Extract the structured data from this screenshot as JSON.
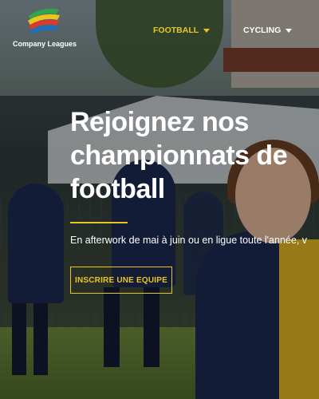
{
  "brand": {
    "name": "Company Leagues"
  },
  "nav": {
    "items": [
      {
        "label": "FOOTBALL",
        "active": true
      },
      {
        "label": "CYCLING",
        "active": false
      }
    ]
  },
  "hero": {
    "title": "Rejoignez nos championnats de football",
    "subtitle": "En afterwork de mai à juin ou en ligue toute l'année, v",
    "cta_label": "INSCRIRE UNE EQUIPE"
  },
  "colors": {
    "accent": "#e8c520",
    "text": "#ffffff",
    "logo_colors": [
      "#2fa84a",
      "#e8c520",
      "#d93a2e",
      "#1f6fb7"
    ]
  }
}
